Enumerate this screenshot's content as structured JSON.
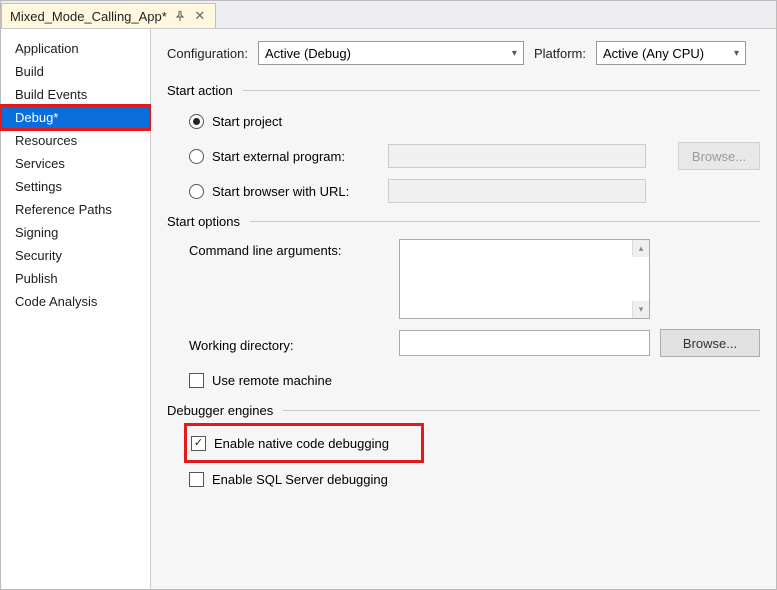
{
  "tab": {
    "title": "Mixed_Mode_Calling_App*"
  },
  "sidebar": {
    "items": [
      {
        "label": "Application"
      },
      {
        "label": "Build"
      },
      {
        "label": "Build Events"
      },
      {
        "label": "Debug*",
        "selected": true,
        "highlighted": true
      },
      {
        "label": "Resources"
      },
      {
        "label": "Services"
      },
      {
        "label": "Settings"
      },
      {
        "label": "Reference Paths"
      },
      {
        "label": "Signing"
      },
      {
        "label": "Security"
      },
      {
        "label": "Publish"
      },
      {
        "label": "Code Analysis"
      }
    ]
  },
  "top": {
    "configuration_label": "Configuration:",
    "configuration_value": "Active (Debug)",
    "platform_label": "Platform:",
    "platform_value": "Active (Any CPU)"
  },
  "start_action": {
    "heading": "Start action",
    "option_project": "Start project",
    "option_external": "Start external program:",
    "option_browser": "Start browser with URL:",
    "browse": "Browse..."
  },
  "start_options": {
    "heading": "Start options",
    "cli_label": "Command line arguments:",
    "wd_label": "Working directory:",
    "browse": "Browse...",
    "remote_label": "Use remote machine"
  },
  "debugger": {
    "heading": "Debugger engines",
    "native_label": "Enable native code debugging",
    "sql_label": "Enable SQL Server debugging"
  }
}
